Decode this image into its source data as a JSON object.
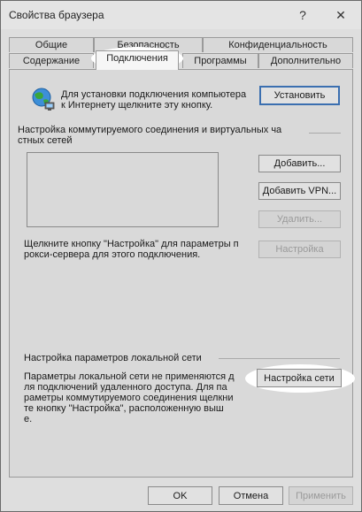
{
  "window": {
    "title": "Свойства браузера",
    "help_label": "?",
    "close_label": "✕"
  },
  "tabs": {
    "row_back": [
      {
        "label": "Общие"
      },
      {
        "label": "Безопасность"
      },
      {
        "label": "Конфиденциальность"
      }
    ],
    "row_front": [
      {
        "label": "Содержание"
      },
      {
        "label": "Подключения"
      },
      {
        "label": "Программы"
      },
      {
        "label": "Дополнительно"
      }
    ],
    "active": "Подключения"
  },
  "setup": {
    "icon": "globe-network-icon",
    "text": "Для установки подключения компьютера\nк Интернету щелкните эту кнопку.",
    "button": "Установить"
  },
  "dialup": {
    "title": "Настройка коммутируемого соединения и виртуальных ча\nстных сетей",
    "add_button": "Добавить...",
    "add_vpn_button": "Добавить VPN...",
    "remove_button": "Удалить...",
    "hint": "Щелкните кнопку \"Настройка\" для параметры п\nрокси-сервера для этого подключения.",
    "settings_button": "Настройка"
  },
  "lan": {
    "title": "Настройка параметров локальной сети",
    "text": "Параметры локальной сети не применяются д\nля подключений удаленного доступа. Для па\nраметры коммутируемого соединения щелкни\nте кнопку \"Настройка\", расположенную выш\nе.",
    "button": "Настройка сети"
  },
  "footer": {
    "ok": "OK",
    "cancel": "Отмена",
    "apply": "Применить"
  },
  "colors": {
    "highlight": "#ffffff",
    "focus_border": "#3b6fb0"
  }
}
